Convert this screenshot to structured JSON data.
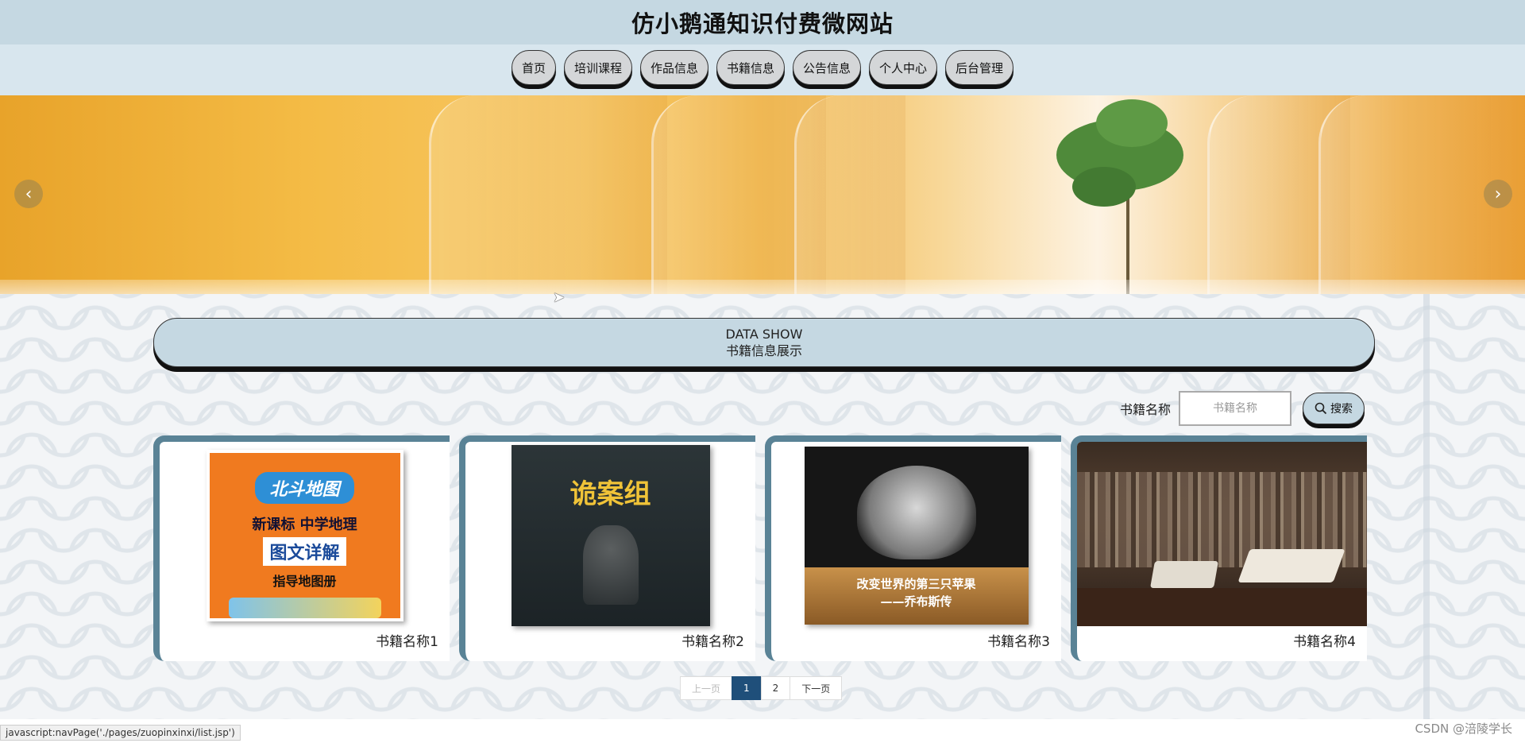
{
  "header": {
    "title": "仿小鹅通知识付费微网站"
  },
  "nav": {
    "items": [
      {
        "label": "首页"
      },
      {
        "label": "培训课程"
      },
      {
        "label": "作品信息"
      },
      {
        "label": "书籍信息"
      },
      {
        "label": "公告信息"
      },
      {
        "label": "个人中心"
      },
      {
        "label": "后台管理"
      }
    ]
  },
  "banner": {
    "prev_icon": "‹",
    "next_icon": "›"
  },
  "section": {
    "title_en": "DATA SHOW",
    "title_zh": "书籍信息展示"
  },
  "search": {
    "label": "书籍名称",
    "placeholder": "书籍名称",
    "button_label": "搜索",
    "button_icon": "search-icon"
  },
  "books": [
    {
      "name": "书籍名称1",
      "cover_logo": "北斗地图",
      "cover_line1": "新课标 中学地理",
      "cover_line2": "图文详解",
      "cover_line3": "指导地图册"
    },
    {
      "name": "书籍名称2",
      "cover_title": "诡案组"
    },
    {
      "name": "书籍名称3",
      "cover_line1": "改变世界的第三只苹果",
      "cover_line2": "——乔布斯传"
    },
    {
      "name": "书籍名称4"
    }
  ],
  "pagination": {
    "prev": "上一页",
    "pages": [
      "1",
      "2"
    ],
    "current": "1",
    "next": "下一页"
  },
  "status_bar": {
    "text": "javascript:navPage('./pages/zuopinxinxi/list.jsp')"
  },
  "watermark": {
    "text": "CSDN @涪陵学长"
  },
  "colors": {
    "header_bg": "#c5d8e2",
    "card_border": "#5a8396",
    "page_active": "#1f4f7a"
  }
}
